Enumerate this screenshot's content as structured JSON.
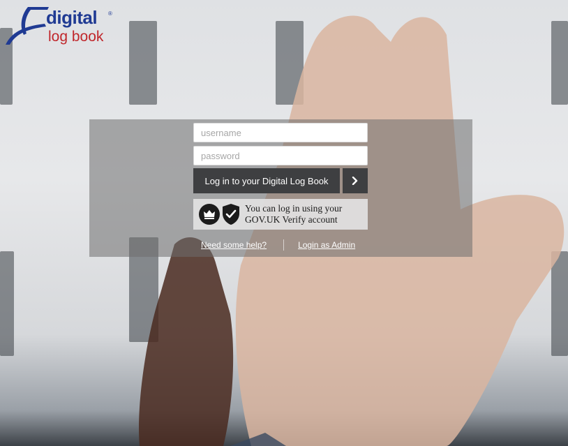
{
  "brand": {
    "logo_word1": "digital",
    "logo_word2": "log book",
    "registered_mark": "®",
    "color_primary": "#1f3a93",
    "color_secondary": "#c0262b"
  },
  "login": {
    "username_placeholder": "username",
    "password_placeholder": "password",
    "submit_label": "Log in to your Digital Log Book",
    "go_icon": "chevron-right-icon"
  },
  "verify": {
    "line1": "You can log in using your",
    "line2": "GOV.UK Verify account",
    "icons": [
      "crown-icon",
      "shield-check-icon"
    ]
  },
  "links": {
    "help": "Need some help?",
    "admin": "Login as Admin"
  }
}
